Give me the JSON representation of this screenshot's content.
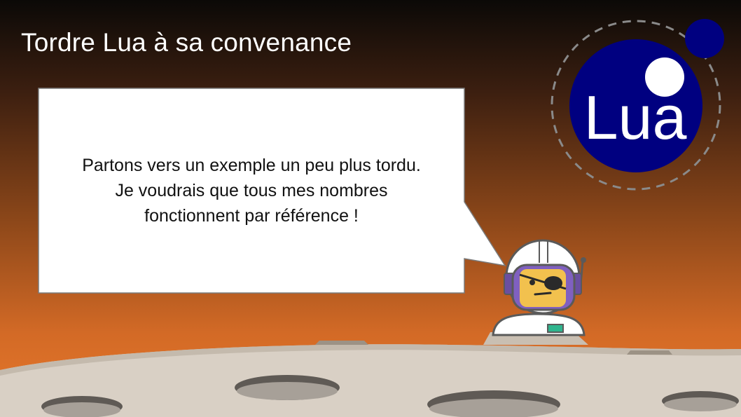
{
  "slide": {
    "title": "Tordre Lua à sa convenance"
  },
  "speech_bubble": {
    "lines": [
      "Partons vers un exemple un peu plus tordu.",
      "Je voudrais que tous mes nombres",
      "fonctionnent par référence !"
    ]
  },
  "logo": {
    "text": "Lua",
    "icon": "lua-logo-icon",
    "colors": {
      "planet": "#000080",
      "moon": "#ffffff",
      "orbit": "#8a8a8a"
    }
  },
  "character": {
    "icon": "astronaut-pirate-icon"
  },
  "colors": {
    "background_top": "#0b0907",
    "background_bottom": "#e8792b",
    "ground": "#d7cfc4",
    "title_text": "#ffffff"
  }
}
